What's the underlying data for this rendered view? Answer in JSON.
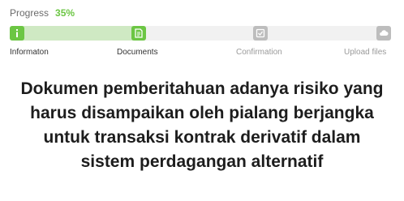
{
  "progress": {
    "label": "Progress",
    "percent_text": "35%",
    "percent": 35
  },
  "steps": [
    {
      "label": "Informaton",
      "icon": "info-icon",
      "state": "done"
    },
    {
      "label": "Documents",
      "icon": "document-icon",
      "state": "done"
    },
    {
      "label": "Confirmation",
      "icon": "confirmation-icon",
      "state": "todo"
    },
    {
      "label": "Upload files",
      "icon": "upload-icon",
      "state": "todo"
    }
  ],
  "colors": {
    "accent": "#6cc644",
    "fill": "#cfe9c3",
    "inactive": "#bdbdbd"
  },
  "document_title": "Dokumen pemberitahuan adanya risiko yang harus disampaikan oleh pialang berjangka untuk transaksi kontrak derivatif dalam sistem perdagangan alternatif"
}
